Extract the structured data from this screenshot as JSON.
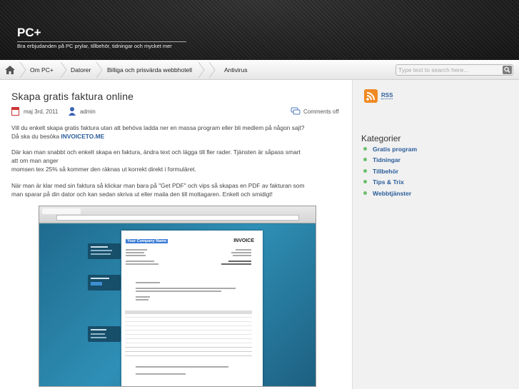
{
  "site": {
    "title": "PC+",
    "tagline": "Bra erbjudanden på PC prylar, tillbehör, tidningar och mycket mer"
  },
  "nav": {
    "home_icon": "home-icon",
    "items": [
      "Om PC+",
      "Datorer",
      "Billiga och prisvärda webbhotell",
      "Antivirus"
    ]
  },
  "search": {
    "placeholder": "Type text to search here...",
    "button_icon": "search-icon"
  },
  "post": {
    "title": "Skapa gratis faktura online",
    "date": "maj 3rd, 2011",
    "author": "admin",
    "comments": "Comments off",
    "p1_text": "Vill du enkelt skapa gratis faktura utan att behöva ladda ner en massa program eller bli medlem på någon sajt?",
    "p1_text2": "Då ska du besöka",
    "p1_link": "INVOICETO.ME",
    "p2_line1": "Där kan man snabbt och enkelt skapa en faktura, ändra text och lägga till fler rader. Tjänsten är såpass smart",
    "p2_line2": "att om man anger",
    "p2_line3": "momsen tex 25% så kommer den räknas ut korrekt direkt i formuläret.",
    "p3_line1": "När man är klar med sin faktura så klickar man bara på \"Get PDF\" och vips så skapas en PDF av fakturan som",
    "p3_line2": "man sparar på din dator och kan sedan skriva ut eller maila den till mottagaren. Enkelt och smidigt!"
  },
  "screenshot": {
    "company": "Your Company Name",
    "heading": "INVOICE"
  },
  "sidebar": {
    "rss_label": "RSS",
    "categories_heading": "Kategorier",
    "categories": [
      "Gratis program",
      "Tidningar",
      "Tillbehör",
      "Tips & Trix",
      "Webbtjänster"
    ]
  }
}
